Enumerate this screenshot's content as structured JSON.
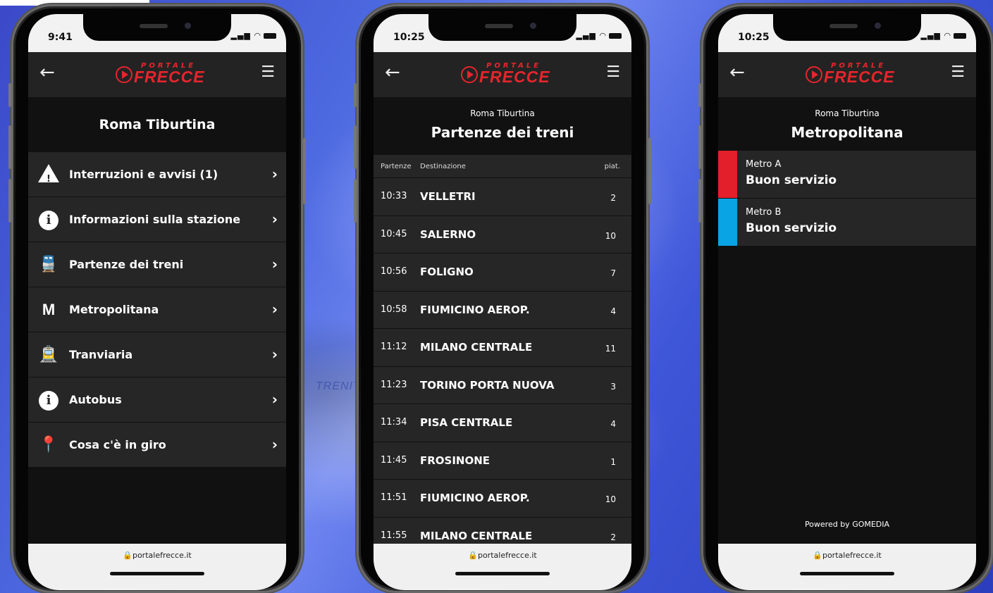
{
  "brand": {
    "logo_top": "PORTALE",
    "logo_main": "FRECCE",
    "red": "#e8242c"
  },
  "url": "portalefrecce.it",
  "phone1": {
    "time": "9:41",
    "title": "Roma Tiburtina",
    "items": [
      {
        "icon": "warning-icon",
        "label": "Interruzioni e avvisi (1)"
      },
      {
        "icon": "info-icon",
        "label": "Informazioni sulla stazione"
      },
      {
        "icon": "train-icon",
        "label": "Partenze dei treni"
      },
      {
        "icon": "metro-icon",
        "label": "Metropolitana"
      },
      {
        "icon": "tram-icon",
        "label": "Tranviaria"
      },
      {
        "icon": "info-icon",
        "label": "Autobus"
      },
      {
        "icon": "location-pin-icon",
        "label": "Cosa c'è in giro"
      }
    ]
  },
  "phone2": {
    "time": "10:25",
    "station": "Roma Tiburtina",
    "title": "Partenze dei treni",
    "columns": {
      "time": "Partenze",
      "dest": "Destinazione",
      "platform": "piat."
    },
    "departures": [
      {
        "time": "10:33",
        "dest": "VELLETRI",
        "platform": "2"
      },
      {
        "time": "10:45",
        "dest": "SALERNO",
        "platform": "10"
      },
      {
        "time": "10:56",
        "dest": "FOLIGNO",
        "platform": "7"
      },
      {
        "time": "10:58",
        "dest": "FIUMICINO AEROP.",
        "platform": "4"
      },
      {
        "time": "11:12",
        "dest": "MILANO CENTRALE",
        "platform": "11"
      },
      {
        "time": "11:23",
        "dest": "TORINO PORTA NUOVA",
        "platform": "3"
      },
      {
        "time": "11:34",
        "dest": "PISA CENTRALE",
        "platform": "4"
      },
      {
        "time": "11:45",
        "dest": "FROSINONE",
        "platform": "1"
      },
      {
        "time": "11:51",
        "dest": "FIUMICINO AEROP.",
        "platform": "10"
      },
      {
        "time": "11:55",
        "dest": "MILANO CENTRALE",
        "platform": "2"
      }
    ]
  },
  "phone3": {
    "time": "10:25",
    "station": "Roma Tiburtina",
    "title": "Metropolitana",
    "lines": [
      {
        "name": "Metro A",
        "status": "Buon servizio",
        "color": "#e21f2a"
      },
      {
        "name": "Metro B",
        "status": "Buon servizio",
        "color": "#08a4e4"
      }
    ],
    "powered": "Powered by GOMEDIA"
  },
  "background_text": "TRENIT"
}
